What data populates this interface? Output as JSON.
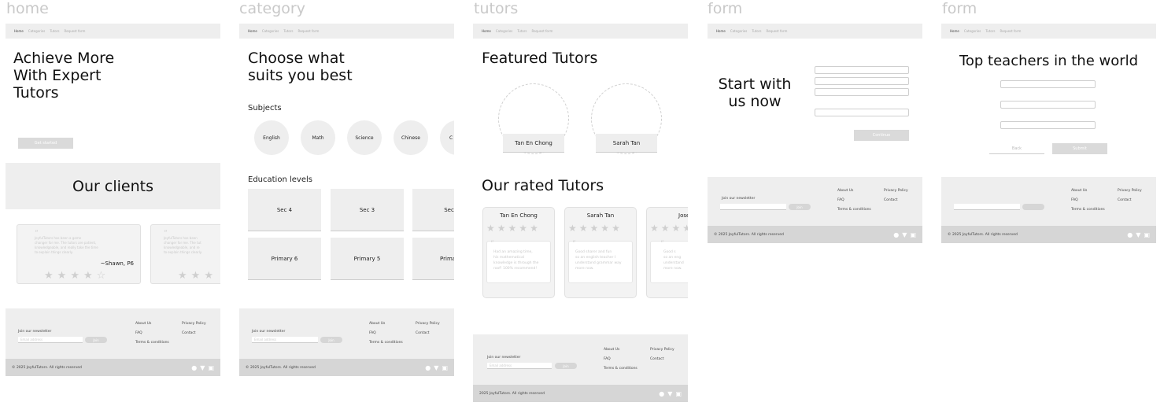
{
  "frames": {
    "home": {
      "title": "home",
      "nav": [
        "Home",
        "Categories",
        "Tutors",
        "Request form"
      ],
      "hero": {
        "line1": "Achieve More",
        "line2": "With Expert",
        "line3": "Tutors",
        "cta": "Get started"
      },
      "clients_heading": "Our clients",
      "testimonial": {
        "text_lines": [
          "JoyfulTutors has been a game",
          "changer for me. The tutors are patient,",
          "knowledgeable, and really take the time",
          "to explain things clearly."
        ],
        "author": "~Shawn, P6",
        "rating": 4
      },
      "testimonial2": {
        "text_lines": [
          "JoyfulTutors has been",
          "changer for me. The tut",
          "knowledgeable, and re",
          "to explain things clearly."
        ]
      }
    },
    "category": {
      "title": "category",
      "nav": [
        "Home",
        "Categories",
        "Tutors",
        "Request form"
      ],
      "hero": {
        "line1": "Choose what",
        "line2": "suits you best"
      },
      "subjects_label": "Subjects",
      "subjects": [
        "English",
        "Math",
        "Science",
        "Chinese",
        "C"
      ],
      "levels_label": "Education levels",
      "levels_row1": [
        "Sec 4",
        "Sec 3",
        "Sec"
      ],
      "levels_row2": [
        "Primary 6",
        "Primary 5",
        "Primar"
      ]
    },
    "tutors": {
      "title": "tutors",
      "nav": [
        "Home",
        "Categories",
        "Tutors",
        "Request form"
      ],
      "featured_heading": "Featured Tutors",
      "featured": [
        "Tan En Chong",
        "Sarah Tan"
      ],
      "rated_heading": "Our rated Tutors",
      "rated": [
        {
          "name": "Tan En Chong",
          "quote_lines": [
            "Had an amazing time,",
            "his mathematical",
            "knowledge is through the",
            "roof! 100% recommend!"
          ]
        },
        {
          "name": "Sarah Tan",
          "quote_lines": [
            "Good sharer and fun",
            "so an english teacher I",
            "understand grammar way",
            "more now."
          ]
        },
        {
          "name": "Jose",
          "quote_lines": [
            "Good s",
            "so an eng",
            "understand",
            "more now."
          ]
        }
      ]
    },
    "form1": {
      "title": "form",
      "nav": [
        "Home",
        "Categories",
        "Tutors",
        "Request form"
      ],
      "heading_line1": "Start with",
      "heading_line2": "us now",
      "continue": "Continue"
    },
    "form2": {
      "title": "form",
      "nav": [
        "Home",
        "Categories",
        "Tutors",
        "Request form"
      ],
      "heading": "Top teachers in the world",
      "back": "Back",
      "submit": "Submit"
    }
  },
  "footer": {
    "newsletter": "Join our newsletter",
    "email_placeholder": "Email address",
    "join": "Join",
    "links_col1": [
      "About Us",
      "FAQ",
      "Terms & conditions"
    ],
    "links_col2": [
      "Privacy Policy",
      "Contact"
    ],
    "copyright": "2025 JoyfulTutors. All rights reserved",
    "copyright_symbol": "©"
  },
  "icons": {
    "facebook": "facebook-icon",
    "twitter": "twitter-icon",
    "instagram": "instagram-icon"
  }
}
